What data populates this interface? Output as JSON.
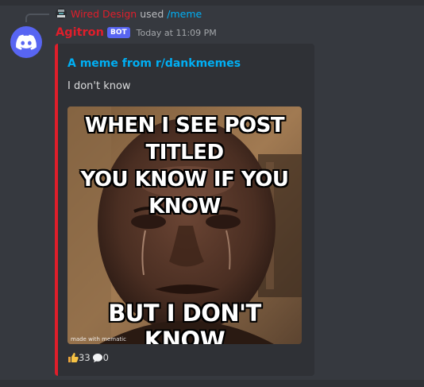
{
  "reply": {
    "user": "Wired Design",
    "used_text": "used",
    "command": "/meme",
    "avatar_icon": "server-avatar-icon"
  },
  "message": {
    "avatar_icon": "discord-logo-icon",
    "username": "Agitron",
    "bot_tag": "BOT",
    "timestamp": "Today at 11:09 PM",
    "name_color": "#e01e2b"
  },
  "embed": {
    "accent_color": "#e01e2b",
    "title": "A meme from r/dankmemes",
    "description": "I don't know",
    "image": {
      "top_text": [
        "WHEN I SEE POST TITLED",
        "YOU KNOW IF YOU KNOW"
      ],
      "bottom_text": "BUT I DON'T KNOW",
      "watermark": "made with mematic"
    },
    "footer": {
      "upvote_icon": "thumbs-up-icon",
      "upvotes": "33",
      "comment_icon": "speech-bubble-icon",
      "comments": "0"
    }
  }
}
